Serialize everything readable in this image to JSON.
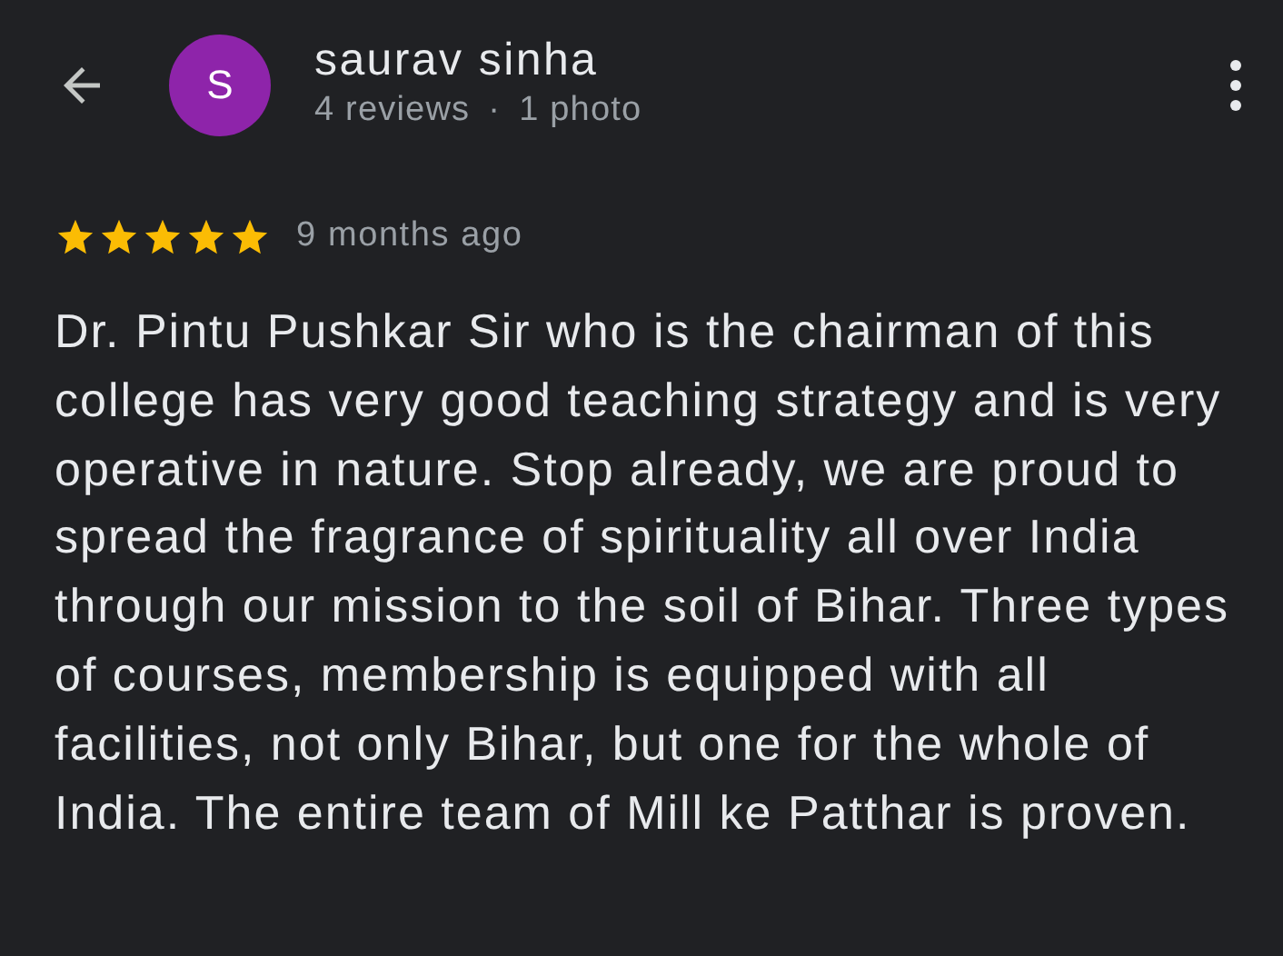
{
  "reviewer": {
    "initial": "S",
    "name": "saurav sinha",
    "reviews": "4 reviews",
    "separator": "·",
    "photos": "1 photo"
  },
  "review": {
    "stars": 5,
    "time": "9 months ago",
    "text": "Dr. Pintu Pushkar Sir who is the chairman of this college has very good teaching strategy and is very operative in nature. Stop already, we are proud to spread the fragrance of spirituality all over India through our mission to the soil of Bihar. Three types of courses, membership is equipped with all facilities, not only Bihar, but one for the whole of India. The entire team of Mill ke Patthar is proven."
  }
}
